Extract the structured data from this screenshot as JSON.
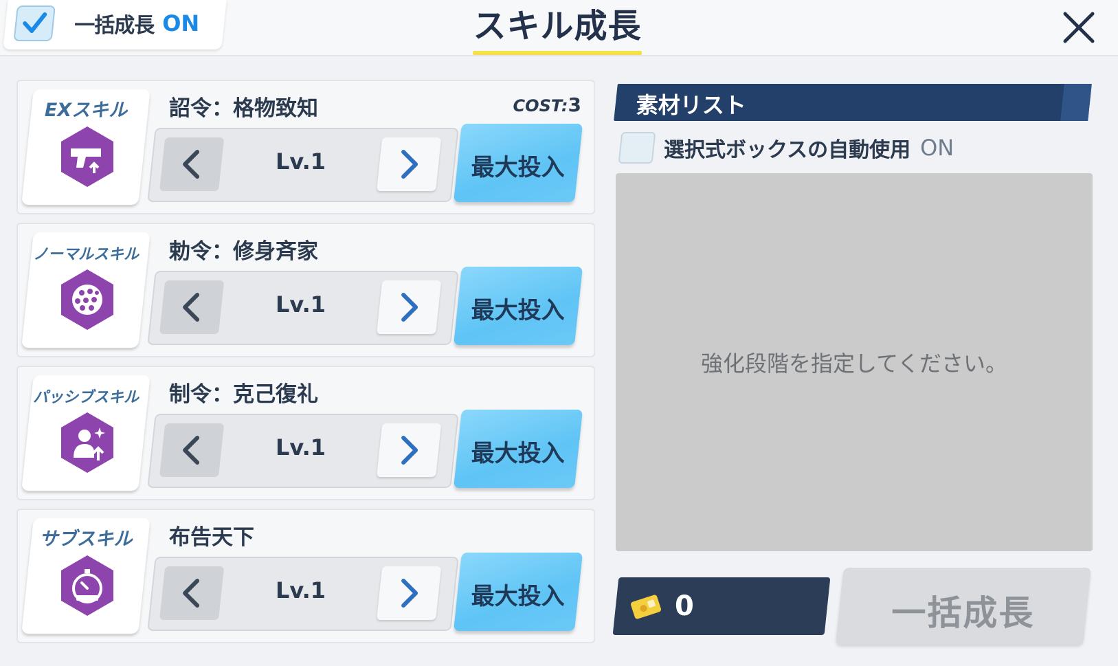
{
  "header": {
    "bulk_label": "一括成長",
    "bulk_state": "ON",
    "title": "スキル成長"
  },
  "skills": [
    {
      "type": "EXスキル",
      "name": "詔令：格物致知",
      "cost_label": "COST:",
      "cost_value": "3",
      "level": "Lv.1",
      "max_label": "最大投入",
      "icon": "handgun-icon"
    },
    {
      "type": "ノーマルスキル",
      "name": "勅令：修身斉家",
      "level": "Lv.1",
      "max_label": "最大投入",
      "icon": "dotted-sphere-icon"
    },
    {
      "type": "パッシブスキル",
      "name": "制令：克己復礼",
      "level": "Lv.1",
      "max_label": "最大投入",
      "icon": "person-up-icon"
    },
    {
      "type": "サブスキル",
      "name": "布告天下",
      "level": "Lv.1",
      "max_label": "最大投入",
      "icon": "cost-timer-icon"
    }
  ],
  "materials": {
    "title": "素材リスト",
    "auto_label": "選択式ボックスの自動使用",
    "auto_state": "ON",
    "hint": "強化段階を指定してください。"
  },
  "footer": {
    "credit_value": "0",
    "grow_label": "一括成長"
  },
  "colors": {
    "accent_blue": "#1a8ae6",
    "skill_purple": "#8e44ad",
    "max_button": "#5fc4f5",
    "navy": "#23406a",
    "title_underline": "#f5e04a"
  }
}
